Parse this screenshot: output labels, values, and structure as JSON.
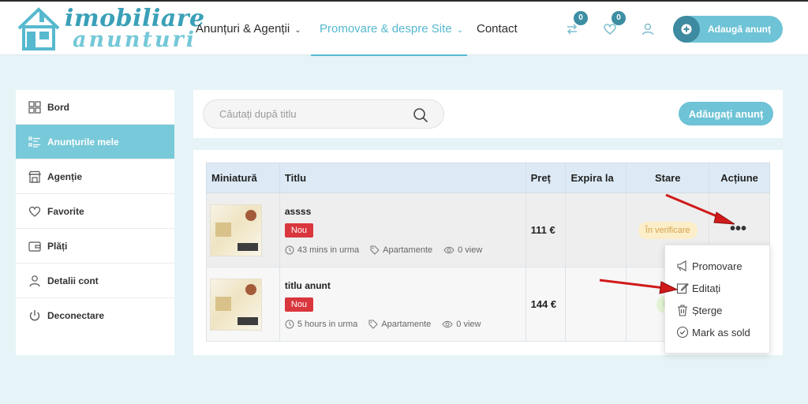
{
  "header": {
    "logo_line1": "imobiliare",
    "logo_line2": "anunturi",
    "nav": [
      {
        "label": "Anunțuri & Agenții"
      },
      {
        "label": "Promovare & despre Site"
      },
      {
        "label": "Contact"
      }
    ],
    "compare_count": "0",
    "favorites_count": "0",
    "add_listing_label": "Adaugă anunț"
  },
  "sidebar": {
    "items": [
      {
        "label": "Bord",
        "icon": "dashboard-icon"
      },
      {
        "label": "Anunțurile mele",
        "icon": "list-icon"
      },
      {
        "label": "Agenție",
        "icon": "store-icon"
      },
      {
        "label": "Favorite",
        "icon": "heart-icon"
      },
      {
        "label": "Plăți",
        "icon": "wallet-icon"
      },
      {
        "label": "Detalii cont",
        "icon": "user-icon"
      },
      {
        "label": "Deconectare",
        "icon": "power-icon"
      }
    ]
  },
  "search": {
    "placeholder": "Căutați după titlu",
    "add_button_label": "Adăugați anunț"
  },
  "table": {
    "headers": [
      "Miniatură",
      "Titlu",
      "Preț",
      "Expira la",
      "Stare",
      "Acțiune"
    ],
    "rows": [
      {
        "title": "assss",
        "tag": "Nou",
        "time": "43 mins in urma",
        "category": "Apartamente",
        "views": "0 view",
        "price": "111 €",
        "expires": "",
        "status": "În verificare"
      },
      {
        "title": "titlu anunt",
        "tag": "Nou",
        "time": "5 hours in urma",
        "category": "Apartamente",
        "views": "0 view",
        "price": "144 €",
        "expires": "",
        "status": "Pr"
      }
    ]
  },
  "actions_menu": {
    "dots": "•••",
    "items": [
      {
        "label": "Promovare",
        "icon": "megaphone-icon"
      },
      {
        "label": "Editați",
        "icon": "edit-icon"
      },
      {
        "label": "Șterge",
        "icon": "trash-icon"
      },
      {
        "label": "Mark as sold",
        "icon": "check-circle-icon"
      }
    ]
  },
  "colors": {
    "accent": "#56b9cf",
    "sidebar_active": "#78c9d9",
    "new_tag": "#d9363e",
    "arrow": "#d01a1a"
  }
}
